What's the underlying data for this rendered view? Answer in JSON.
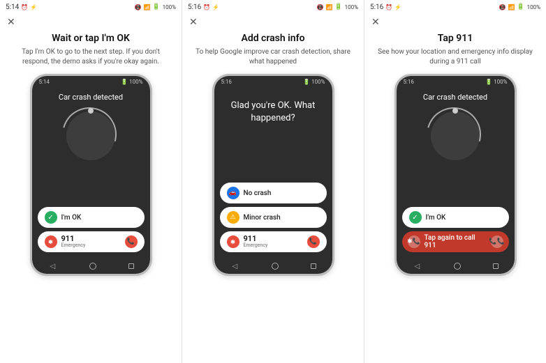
{
  "panels": [
    {
      "id": "panel1",
      "status": {
        "time": "5:14",
        "battery": "100%"
      },
      "title": "Wait or tap I'm OK",
      "description": "Tap I'm OK to go to the next step. If you don't respond, the demo asks if you're okay again.",
      "phone": {
        "detected_text": "Car crash detected",
        "buttons": {
          "ok_label": "I'm OK",
          "emergency_number": "911",
          "emergency_sub": "Emergency"
        }
      }
    },
    {
      "id": "panel2",
      "status": {
        "time": "5:16",
        "battery": "100%"
      },
      "title": "Add crash info",
      "description": "To help Google improve car crash detection, share what happened",
      "phone": {
        "glad_text": "Glad you're OK. What happened?",
        "options": [
          {
            "label": "No crash",
            "type": "no-crash"
          },
          {
            "label": "Minor crash",
            "type": "minor-crash"
          }
        ],
        "emergency_number": "911",
        "emergency_sub": "Emergency"
      }
    },
    {
      "id": "panel3",
      "status": {
        "time": "5:16",
        "battery": "100%"
      },
      "title": "Tap 911",
      "description": "See how your location and emergency info display during a 911 call",
      "phone": {
        "detected_text": "Car crash detected",
        "buttons": {
          "ok_label": "I'm OK",
          "tap_again_label": "Tap again to call 911"
        }
      }
    }
  ],
  "nav": {
    "back": "◁",
    "home": "○",
    "recent": "□"
  },
  "icons": {
    "close": "✕",
    "phone": "📞",
    "sos": "✱",
    "check": "✓",
    "car": "🚗",
    "warning": "⚠"
  }
}
